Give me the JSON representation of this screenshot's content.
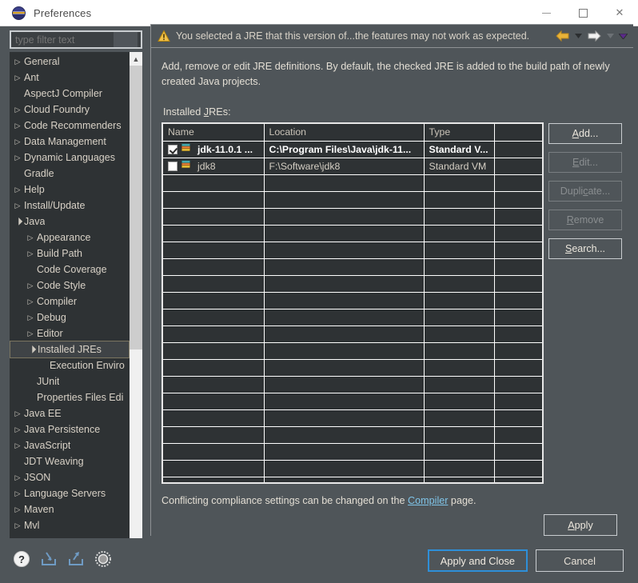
{
  "window": {
    "title": "Preferences",
    "icon": "eclipse-icon",
    "controls": {
      "minimize": "minimize-button",
      "maximize": "maximize-button",
      "close": "close-button"
    }
  },
  "filter": {
    "placeholder": "type filter text",
    "value": ""
  },
  "tree": {
    "items": [
      {
        "label": "General",
        "level": 1,
        "state": "collapsed",
        "selected": false
      },
      {
        "label": "Ant",
        "level": 1,
        "state": "collapsed",
        "selected": false
      },
      {
        "label": "AspectJ Compiler",
        "level": 1,
        "state": "none",
        "selected": false
      },
      {
        "label": "Cloud Foundry",
        "level": 1,
        "state": "collapsed",
        "selected": false
      },
      {
        "label": "Code Recommenders",
        "level": 1,
        "state": "collapsed",
        "selected": false
      },
      {
        "label": "Data Management",
        "level": 1,
        "state": "collapsed",
        "selected": false
      },
      {
        "label": "Dynamic Languages",
        "level": 1,
        "state": "collapsed",
        "selected": false
      },
      {
        "label": "Gradle",
        "level": 1,
        "state": "none",
        "selected": false
      },
      {
        "label": "Help",
        "level": 1,
        "state": "collapsed",
        "selected": false
      },
      {
        "label": "Install/Update",
        "level": 1,
        "state": "collapsed",
        "selected": false
      },
      {
        "label": "Java",
        "level": 1,
        "state": "expanded",
        "selected": false
      },
      {
        "label": "Appearance",
        "level": 2,
        "state": "collapsed",
        "selected": false
      },
      {
        "label": "Build Path",
        "level": 2,
        "state": "collapsed",
        "selected": false
      },
      {
        "label": "Code Coverage",
        "level": 2,
        "state": "none",
        "selected": false
      },
      {
        "label": "Code Style",
        "level": 2,
        "state": "collapsed",
        "selected": false
      },
      {
        "label": "Compiler",
        "level": 2,
        "state": "collapsed",
        "selected": false
      },
      {
        "label": "Debug",
        "level": 2,
        "state": "collapsed",
        "selected": false
      },
      {
        "label": "Editor",
        "level": 2,
        "state": "collapsed",
        "selected": false
      },
      {
        "label": "Installed JREs",
        "level": 2,
        "state": "expanded",
        "selected": true
      },
      {
        "label": "Execution Enviro",
        "level": 3,
        "state": "none",
        "selected": false
      },
      {
        "label": "JUnit",
        "level": 2,
        "state": "none",
        "selected": false
      },
      {
        "label": "Properties Files Edi",
        "level": 2,
        "state": "none",
        "selected": false
      },
      {
        "label": "Java EE",
        "level": 1,
        "state": "collapsed",
        "selected": false
      },
      {
        "label": "Java Persistence",
        "level": 1,
        "state": "collapsed",
        "selected": false
      },
      {
        "label": "JavaScript",
        "level": 1,
        "state": "collapsed",
        "selected": false
      },
      {
        "label": "JDT Weaving",
        "level": 1,
        "state": "none",
        "selected": false
      },
      {
        "label": "JSON",
        "level": 1,
        "state": "collapsed",
        "selected": false
      },
      {
        "label": "Language Servers",
        "level": 1,
        "state": "collapsed",
        "selected": false
      },
      {
        "label": "Maven",
        "level": 1,
        "state": "collapsed",
        "selected": false
      },
      {
        "label": "Mvl",
        "level": 1,
        "state": "collapsed",
        "selected": false
      }
    ],
    "scrollbars": {
      "vertical_up": "scroll-up-icon",
      "vertical_down": "scroll-down-icon",
      "horizontal_left": "scroll-left-icon",
      "horizontal_right": "scroll-right-icon"
    }
  },
  "warning": {
    "icon": "warning-icon",
    "message": "You selected a JRE that this version of...the features may not work as expected.",
    "nav": {
      "back": "back-arrow-icon",
      "back_menu": "back-dropdown-icon",
      "forward": "forward-arrow-icon",
      "forward_menu": "forward-dropdown-icon",
      "more": "more-dropdown-icon"
    }
  },
  "page": {
    "description": "Add, remove or edit JRE definitions. By default, the checked JRE is added to the build path of newly created Java projects.",
    "section_label_prefix": "Installed ",
    "section_label_mnemonic": "J",
    "section_label_suffix": "REs:",
    "table": {
      "columns": [
        "Name",
        "Location",
        "Type",
        ""
      ],
      "rows": [
        {
          "checked": true,
          "name": "jdk-11.0.1 ...",
          "location": "C:\\Program Files\\Java\\jdk-11...",
          "type": "Standard V...",
          "extra": ""
        },
        {
          "checked": false,
          "name": "jdk8",
          "location": "F:\\Software\\jdk8",
          "type": "Standard VM",
          "extra": ""
        }
      ],
      "empty_row_count": 19
    },
    "buttons": [
      {
        "label": "Add...",
        "mnemonic_index": 0,
        "enabled": true,
        "name": "add-button"
      },
      {
        "label": "Edit...",
        "mnemonic_index": 0,
        "enabled": false,
        "name": "edit-button"
      },
      {
        "label": "Duplicate...",
        "mnemonic_index": 5,
        "enabled": false,
        "name": "duplicate-button"
      },
      {
        "label": "Remove",
        "mnemonic_index": 0,
        "enabled": false,
        "name": "remove-button"
      },
      {
        "label": "Search...",
        "mnemonic_index": 0,
        "enabled": true,
        "name": "search-button"
      }
    ],
    "footer_note_prefix": "Conflicting compliance settings can be changed on the ",
    "footer_link": "Compiler",
    "footer_note_suffix": " page.",
    "apply_label": "Apply",
    "apply_mnemonic": "A"
  },
  "bottom": {
    "icons": [
      {
        "name": "help-icon"
      },
      {
        "name": "import-icon"
      },
      {
        "name": "export-icon"
      },
      {
        "name": "restore-defaults-icon"
      }
    ],
    "apply_and_close": "Apply and Close",
    "cancel": "Cancel"
  },
  "colors": {
    "background": "#4f5559",
    "panel": "#2e3234",
    "accent": "#2e8fd8",
    "link": "#7fc4e8",
    "warning": "#e8b339",
    "text": "#e3ded4"
  }
}
